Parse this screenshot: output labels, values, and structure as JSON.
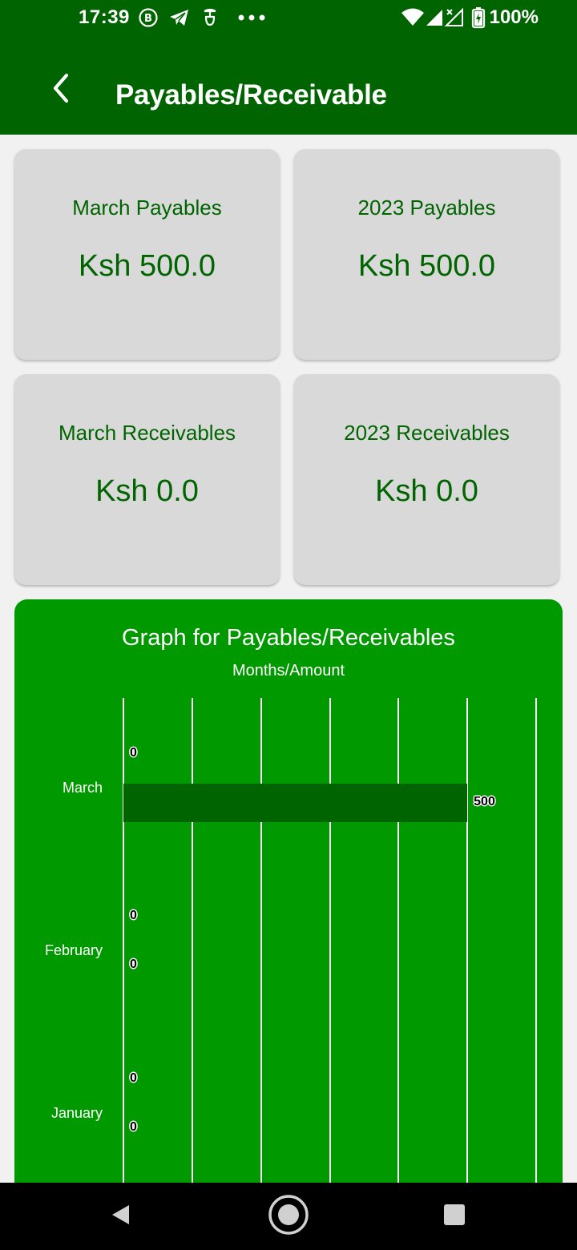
{
  "status_bar": {
    "time": "17:39",
    "battery": "100%",
    "icons": [
      "b-circle-icon",
      "telegram-icon",
      "sim-icon",
      "more-dots-icon",
      "wifi-icon",
      "signal-icon",
      "signal-x-icon",
      "battery-charging-icon"
    ]
  },
  "header": {
    "title": "Payables/Receivable"
  },
  "cards": [
    {
      "label": "March Payables",
      "value": "Ksh 500.0"
    },
    {
      "label": "2023 Payables",
      "value": "Ksh 500.0"
    },
    {
      "label": "March Receivables",
      "value": "Ksh 0.0"
    },
    {
      "label": "2023 Receivables",
      "value": "Ksh 0.0"
    }
  ],
  "colors": {
    "primary": "#006400",
    "graph_background": "#009900",
    "card_background": "#d9d9d9",
    "bar": "#006400"
  },
  "chart_data": {
    "type": "bar",
    "orientation": "horizontal",
    "title": "Graph for Payables/Receivables",
    "subtitle": "Months/Amount",
    "categories": [
      "March",
      "February",
      "January"
    ],
    "series": [
      {
        "values": [
          0,
          0,
          0
        ]
      },
      {
        "values": [
          500,
          0,
          0
        ]
      }
    ],
    "data_labels": [
      [
        "0",
        "0",
        "0"
      ],
      [
        "500",
        "0",
        "0"
      ]
    ],
    "xlim": [
      0,
      600
    ],
    "grid": true
  },
  "nav_bar": {
    "items": [
      "back-triangle-icon",
      "home-circle-icon",
      "recents-square-icon"
    ]
  }
}
